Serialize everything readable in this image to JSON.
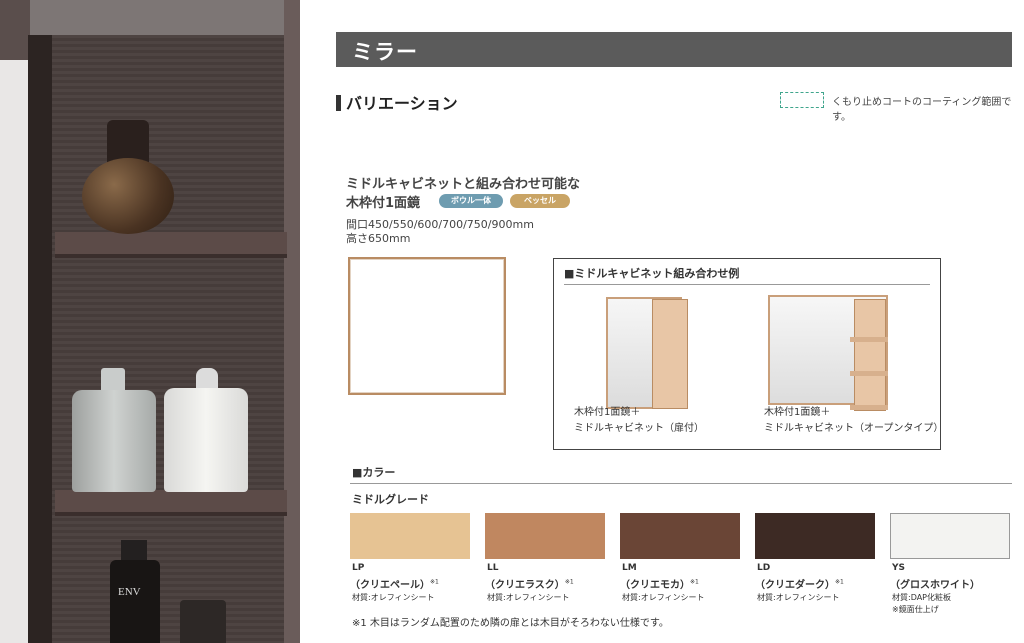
{
  "header": {
    "title": "ミラー"
  },
  "section": {
    "title": "バリエーション"
  },
  "legend": {
    "text": "くもり止めコートのコーティング範囲です。"
  },
  "product": {
    "title_line1": "ミドルキャビネットと組み合わせ可能な",
    "title_line2": "木枠付1面鏡",
    "badges": [
      "ボウル一体",
      "ベッセル"
    ],
    "width": "間口450/550/600/700/750/900mm",
    "height": "高さ650mm"
  },
  "combo": {
    "title": "■ミドルキャビネット組み合わせ例",
    "items": [
      {
        "line1": "木枠付1面鏡＋",
        "line2": "ミドルキャビネット（扉付）"
      },
      {
        "line1": "木枠付1面鏡＋",
        "line2": "ミドルキャビネット（オープンタイプ）"
      }
    ]
  },
  "colors": {
    "section_title": "■カラー",
    "grade": "ミドルグレード",
    "swatches": [
      {
        "code": "LP",
        "name": "（クリエペール）",
        "sup": "※1",
        "material": "材質:オレフィンシート",
        "extra": "",
        "color": "#e6c393"
      },
      {
        "code": "LL",
        "name": "（クリエラスク）",
        "sup": "※1",
        "material": "材質:オレフィンシート",
        "extra": "",
        "color": "#c08760"
      },
      {
        "code": "LM",
        "name": "（クリエモカ）",
        "sup": "※1",
        "material": "材質:オレフィンシート",
        "extra": "",
        "color": "#6a4536"
      },
      {
        "code": "LD",
        "name": "（クリエダーク）",
        "sup": "※1",
        "material": "材質:オレフィンシート",
        "extra": "",
        "color": "#3d2a24"
      },
      {
        "code": "YS",
        "name": "（グロスホワイト）",
        "sup": "",
        "material": "材質:DAP化粧板",
        "extra": "※鏡面仕上げ",
        "color": "#f3f3f1"
      }
    ],
    "note": "※1 木目はランダム配置のため隣の扉とは木目がそろわない仕様です。"
  },
  "photo": {
    "bottle_label": "ENV"
  }
}
